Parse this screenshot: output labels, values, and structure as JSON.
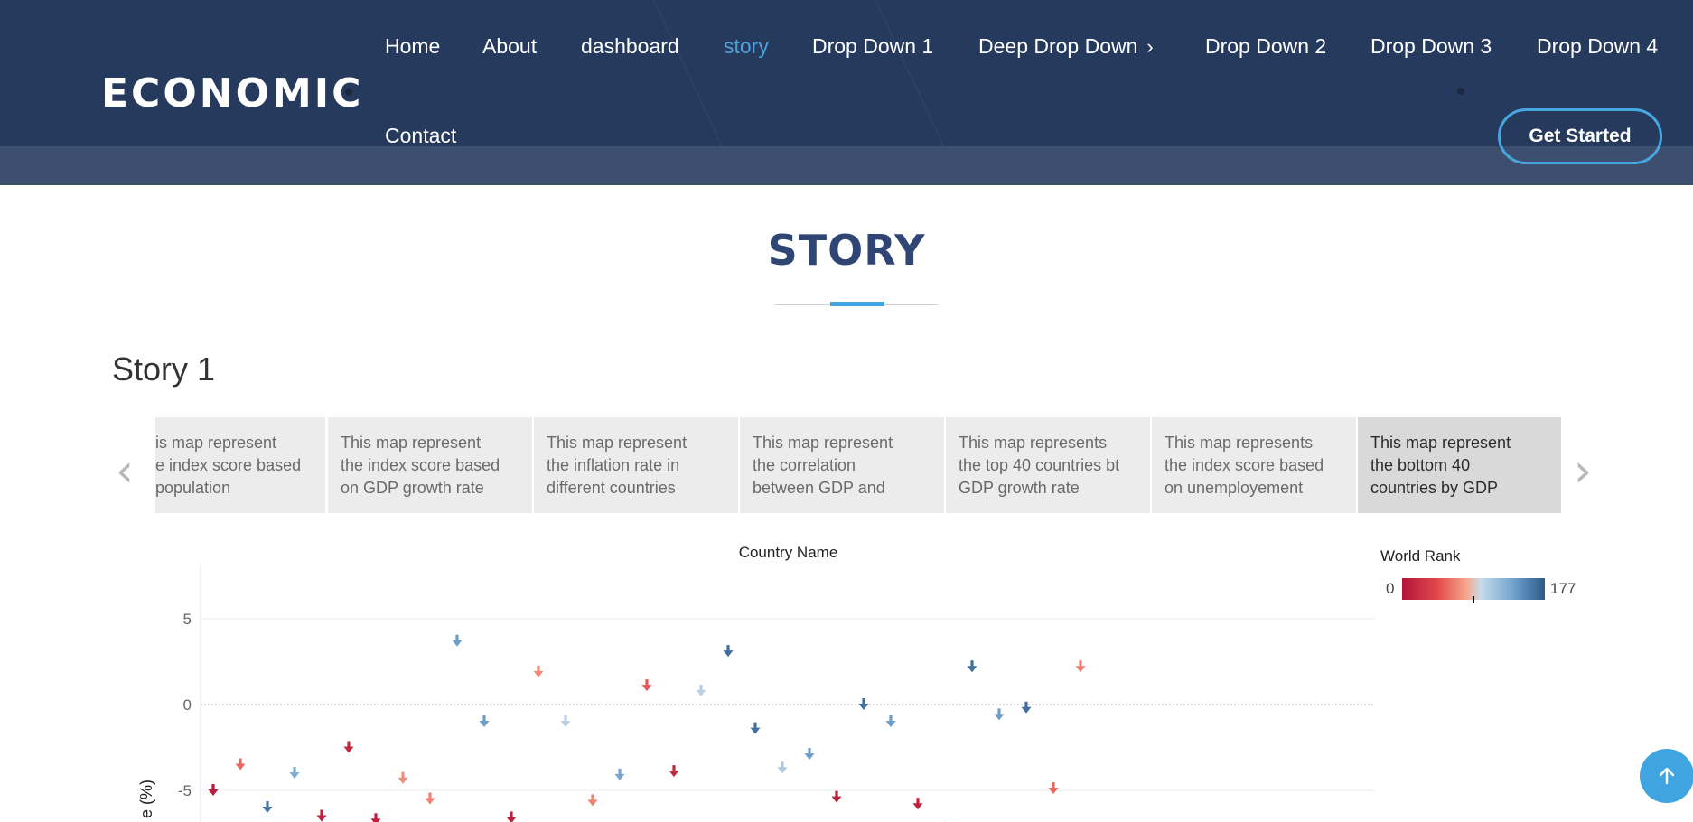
{
  "header": {
    "logo": "ECONOMIC",
    "nav": [
      {
        "label": "Home",
        "active": false
      },
      {
        "label": "About",
        "active": false
      },
      {
        "label": "dashboard",
        "active": false
      },
      {
        "label": "story",
        "active": true
      },
      {
        "label": "Drop Down 1",
        "active": false
      },
      {
        "label": "Deep Drop Down",
        "active": false,
        "chevron": "chevron-right-icon"
      },
      {
        "label": "Drop Down 2",
        "active": false
      },
      {
        "label": "Drop Down 3",
        "active": false
      },
      {
        "label": "Drop Down 4",
        "active": false
      },
      {
        "label": "Contact",
        "active": false
      }
    ],
    "cta": "Get Started"
  },
  "main": {
    "section_title": "STORY",
    "story_heading": "Story 1",
    "story_points": [
      "is map represent\ne index score based\npopulation",
      "This map represent\nthe index score based\non GDP growth rate",
      "This map represent\nthe inflation rate in\ndifferent countries",
      "This map represent\nthe correlation\nbetween GDP and",
      "This map represents\nthe top 40 countries bt\nGDP growth rate",
      "This map represents\nthe index score based\non unemployement",
      "This map represent\nthe bottom 40\ncountries by GDP"
    ],
    "selected_story_point": 6
  },
  "colors": {
    "header_bg": "#263a5e",
    "accent": "#3fa4e0",
    "title": "#2f4675"
  },
  "chart_data": {
    "type": "scatter",
    "title": "Country Name",
    "ylabel": "e (%)",
    "y_ticks": [
      5,
      0,
      -5
    ],
    "ylim": [
      -7,
      7.5
    ],
    "legend": {
      "title": "World Rank",
      "min": "0",
      "max": "177",
      "position": "top-right"
    },
    "marker": "down-arrow",
    "points": [
      {
        "x": 1,
        "y": -5.0,
        "rank": 5
      },
      {
        "x": 2,
        "y": -3.5,
        "rank": 55
      },
      {
        "x": 3,
        "y": -6.0,
        "rank": 160
      },
      {
        "x": 4,
        "y": -4.0,
        "rank": 130
      },
      {
        "x": 5,
        "y": -6.5,
        "rank": 10
      },
      {
        "x": 6,
        "y": -2.5,
        "rank": 15
      },
      {
        "x": 7,
        "y": -6.7,
        "rank": 10
      },
      {
        "x": 8,
        "y": -4.3,
        "rank": 70
      },
      {
        "x": 9,
        "y": -5.5,
        "rank": 65
      },
      {
        "x": 10,
        "y": 3.7,
        "rank": 140
      },
      {
        "x": 11,
        "y": -1.0,
        "rank": 140
      },
      {
        "x": 12,
        "y": -6.6,
        "rank": 10
      },
      {
        "x": 13,
        "y": 1.9,
        "rank": 70
      },
      {
        "x": 14,
        "y": -1.0,
        "rank": 105
      },
      {
        "x": 15,
        "y": -5.6,
        "rank": 65
      },
      {
        "x": 16,
        "y": -4.1,
        "rank": 135
      },
      {
        "x": 17,
        "y": 1.1,
        "rank": 50
      },
      {
        "x": 18,
        "y": -3.9,
        "rank": 15
      },
      {
        "x": 19,
        "y": 0.8,
        "rank": 105
      },
      {
        "x": 20,
        "y": 3.1,
        "rank": 165
      },
      {
        "x": 21,
        "y": -1.4,
        "rank": 165
      },
      {
        "x": 22,
        "y": -3.7,
        "rank": 110
      },
      {
        "x": 23,
        "y": -2.9,
        "rank": 140
      },
      {
        "x": 24,
        "y": -5.4,
        "rank": 10
      },
      {
        "x": 25,
        "y": 0.0,
        "rank": 165
      },
      {
        "x": 26,
        "y": -1.0,
        "rank": 140
      },
      {
        "x": 27,
        "y": -5.8,
        "rank": 10
      },
      {
        "x": 28,
        "y": -7.2,
        "rank": 70
      },
      {
        "x": 29,
        "y": 2.2,
        "rank": 165
      },
      {
        "x": 30,
        "y": -0.6,
        "rank": 140
      },
      {
        "x": 31,
        "y": -0.2,
        "rank": 165
      },
      {
        "x": 32,
        "y": -4.9,
        "rank": 55
      },
      {
        "x": 33,
        "y": 2.2,
        "rank": 65
      }
    ]
  }
}
